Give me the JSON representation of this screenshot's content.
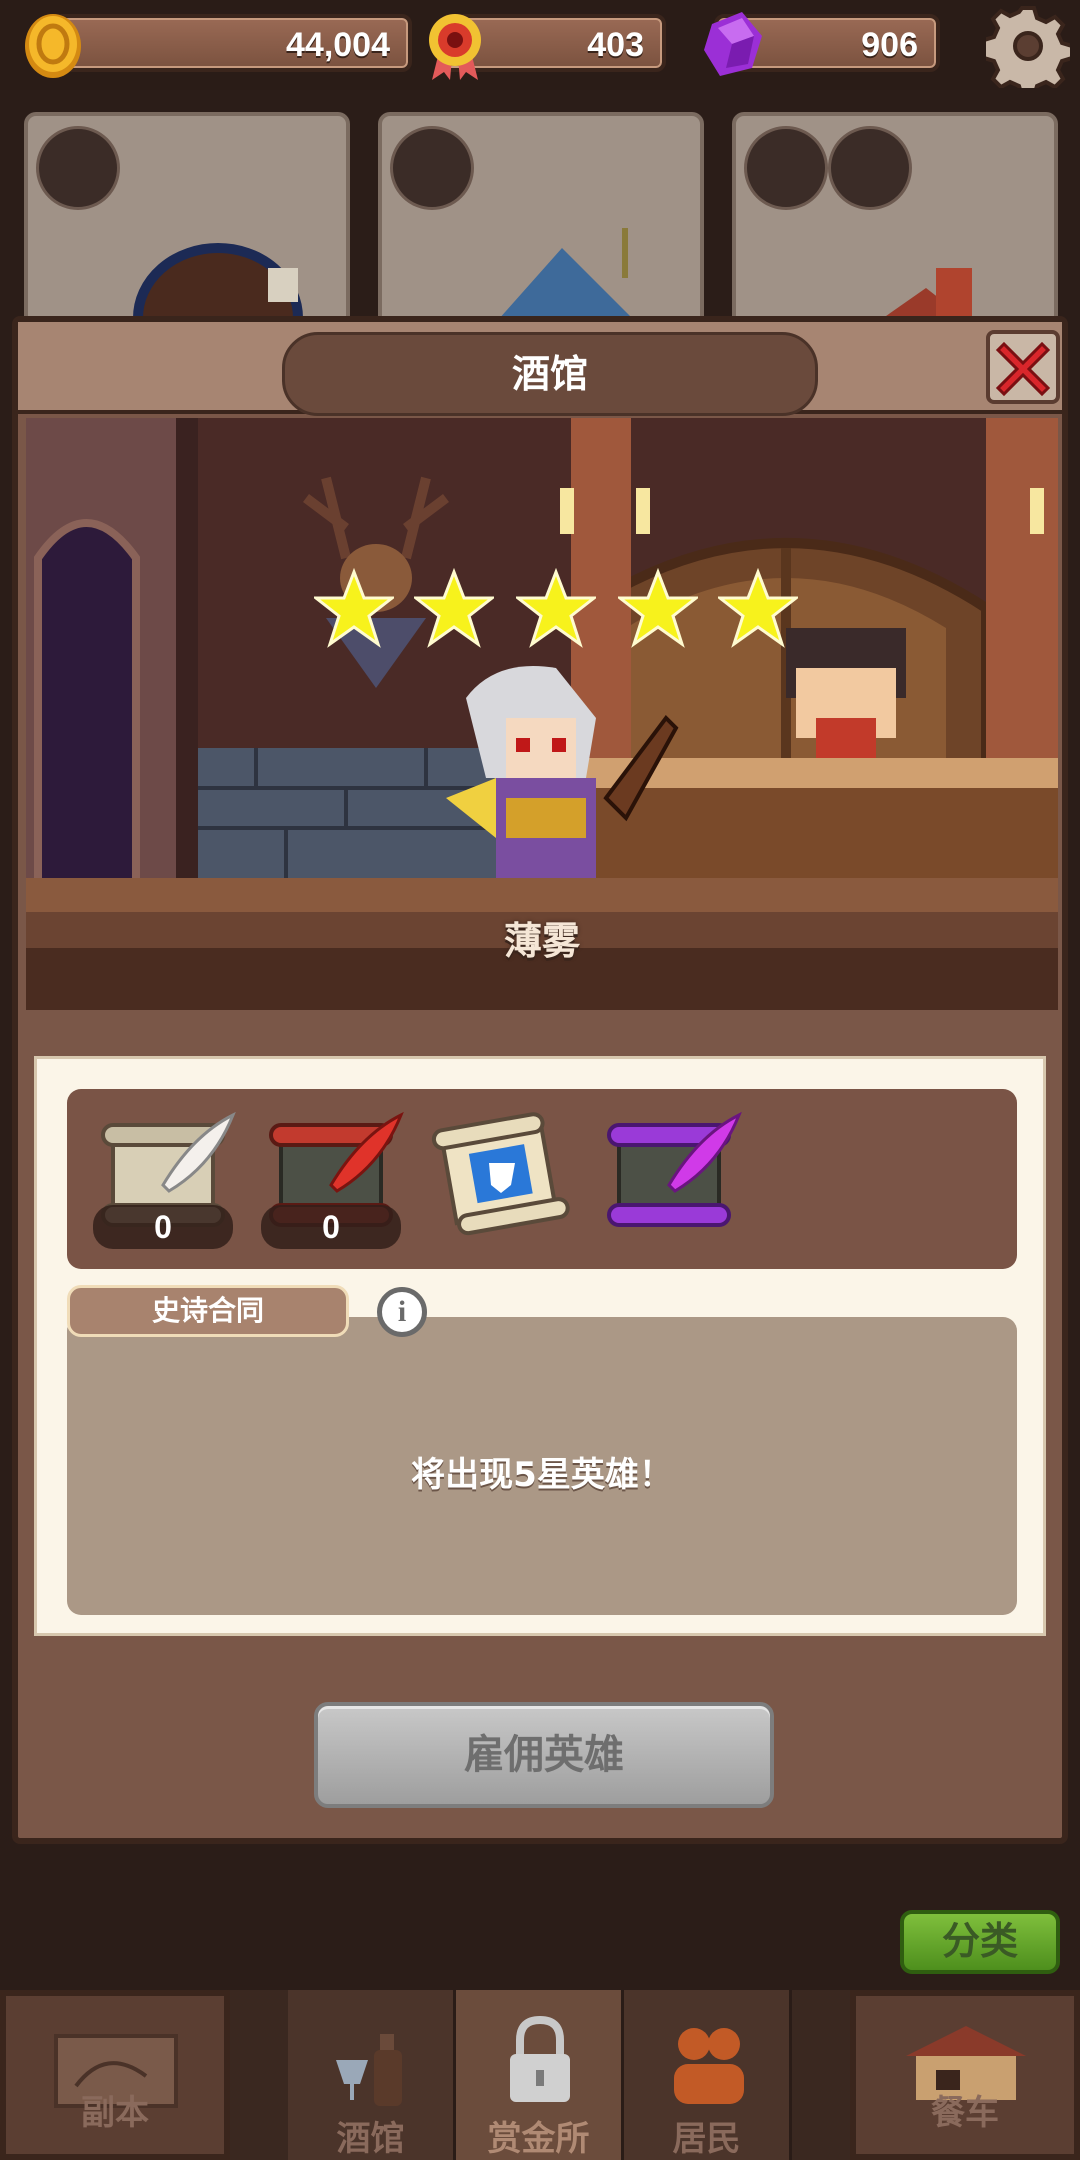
{
  "resources": {
    "coins": "44,004",
    "medals": "403",
    "gems": "906"
  },
  "modal": {
    "title": "酒馆",
    "hero": {
      "name": "薄雾",
      "stars": 5
    },
    "scrolls": [
      {
        "kind": "white-feather-scroll",
        "count": "0"
      },
      {
        "kind": "red-feather-scroll",
        "count": "0"
      },
      {
        "kind": "blue-shield-scroll"
      },
      {
        "kind": "purple-feather-scroll"
      }
    ],
    "contract_tab": "史诗合同",
    "contract_desc": "将出现5星英雄！",
    "hire_label": "雇佣英雄"
  },
  "sort_label": "分类",
  "nav": {
    "dungeon": "副本",
    "tavern": "酒馆",
    "bounty": "赏金所",
    "residents": "居民",
    "cart": "餐车"
  },
  "colors": {
    "accent_green": "#5da62a",
    "close_red": "#d9262b",
    "star_yellow": "#f7f21c"
  }
}
